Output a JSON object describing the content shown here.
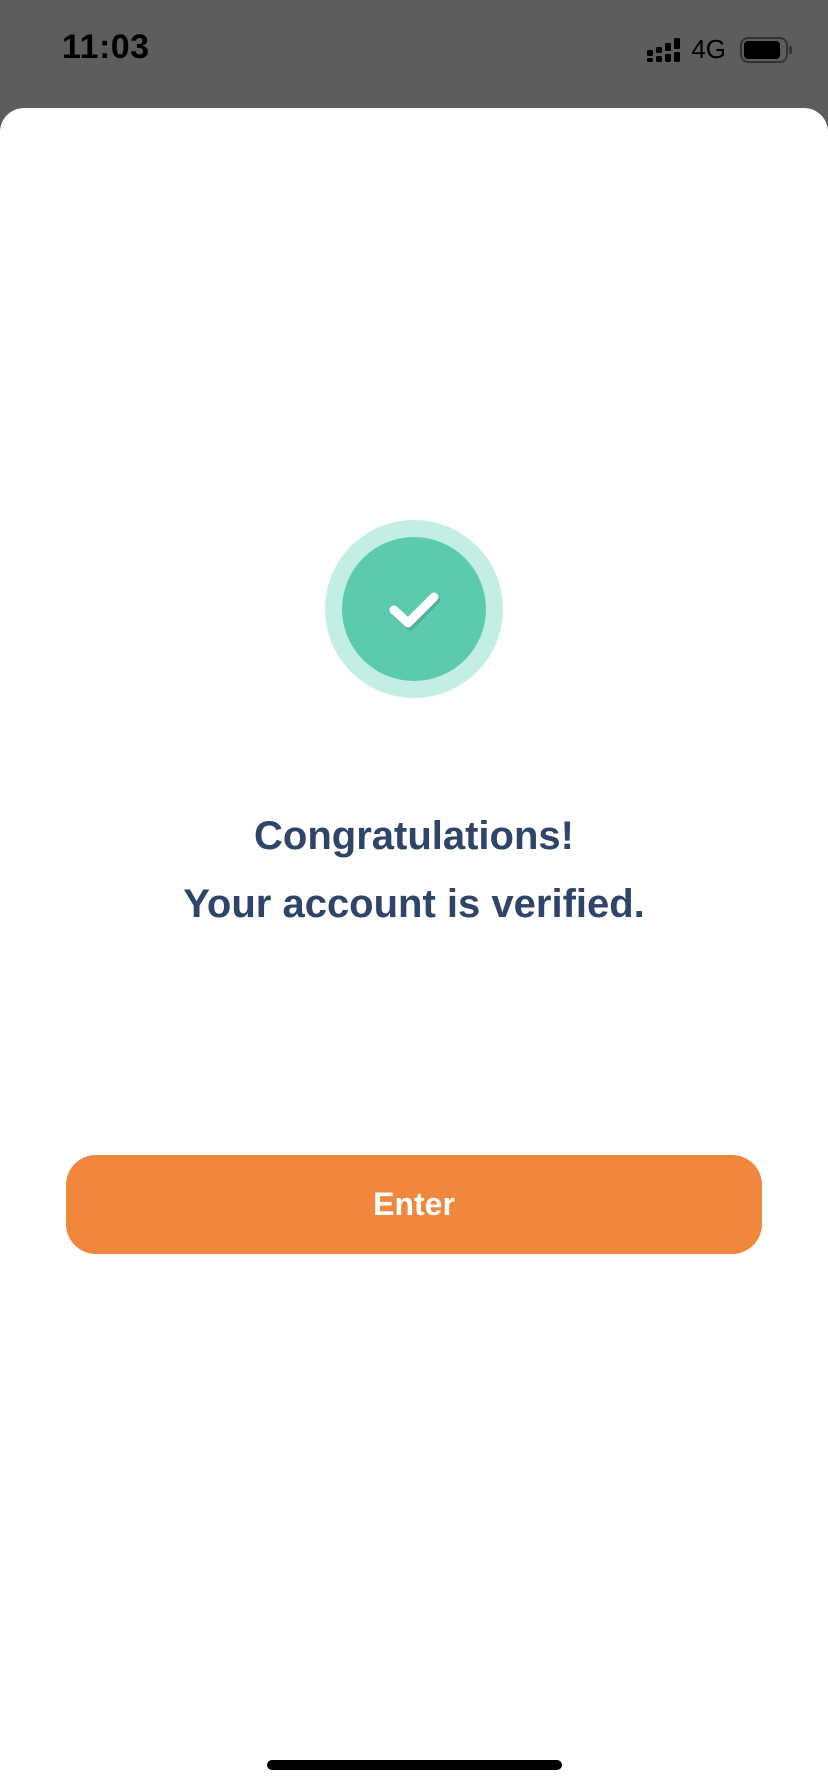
{
  "status_bar": {
    "time": "11:03",
    "network": "4G",
    "signal_icon": "cellular-signal-icon",
    "battery_icon": "battery-icon"
  },
  "content": {
    "icon": "checkmark-circle-icon",
    "title_line_1": "Congratulations!",
    "title_line_2": "Your account is verified."
  },
  "actions": {
    "enter_label": "Enter"
  },
  "colors": {
    "accent": "#f0873c",
    "success": "#5ccbad",
    "success_light": "#c2eee3",
    "text": "#2f4469",
    "backdrop": "#5d5e5b"
  }
}
